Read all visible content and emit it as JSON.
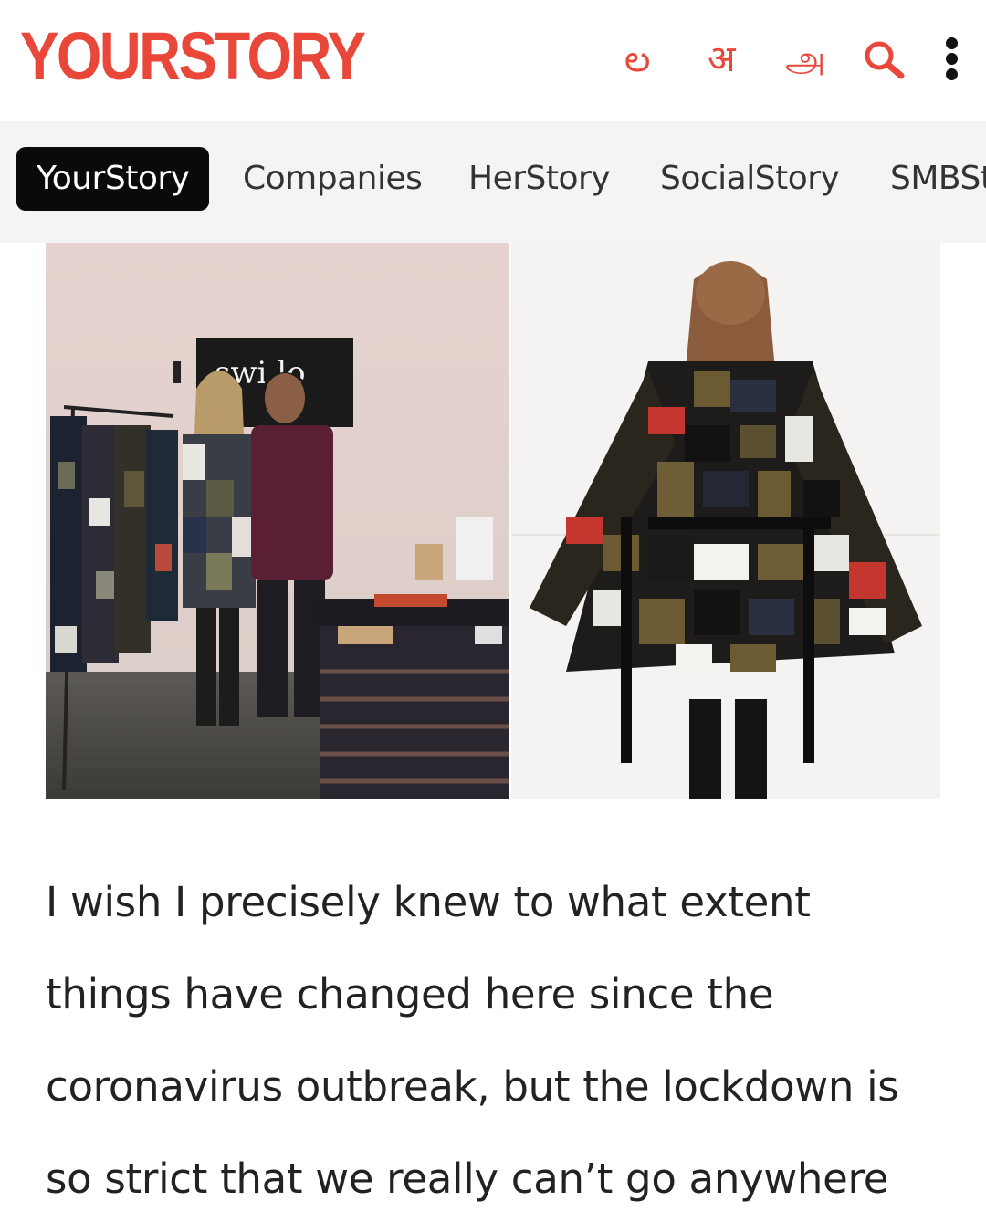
{
  "header": {
    "logo_text": "YOURSTORY",
    "languages": [
      {
        "label": "ల",
        "lang": "Telugu"
      },
      {
        "label": "अ",
        "lang": "Hindi"
      },
      {
        "label": "அ",
        "lang": "Tamil"
      }
    ],
    "search_icon": "search-icon",
    "more_icon": "more-vertical-icon"
  },
  "nav": {
    "tabs": [
      {
        "label": "YourStory",
        "active": true
      },
      {
        "label": "Companies",
        "active": false
      },
      {
        "label": "HerStory",
        "active": false
      },
      {
        "label": "SocialStory",
        "active": false
      },
      {
        "label": "SMBSt",
        "active": false
      }
    ]
  },
  "images": {
    "left_sign_text": "swi lo",
    "left_alt": "",
    "right_alt": ""
  },
  "article": {
    "lines": [
      "I wish I precisely knew to what extent",
      "things have changed here since the",
      "coronavirus outbreak, but the lockdown is",
      "so strict that we really can’t go anywhere"
    ]
  },
  "colors": {
    "brand": "#e8473a",
    "nav_bg": "#f4f4f4",
    "active_tab_bg": "#0a0a0a",
    "text": "#222222"
  }
}
